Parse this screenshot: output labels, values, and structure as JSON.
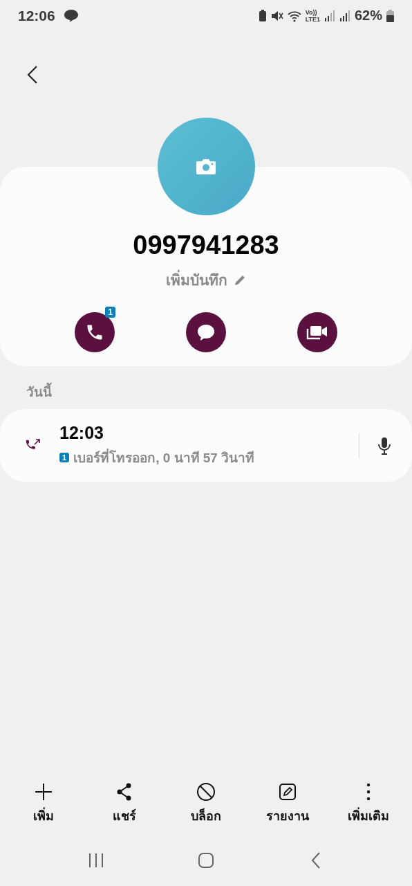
{
  "status_bar": {
    "time": "12:06",
    "volte": "Vo))",
    "network": "LTE1",
    "battery": "62%"
  },
  "contact": {
    "number": "0997941283",
    "note": "เพิ่มบันทึก"
  },
  "actions": [
    {
      "kind": "call",
      "badge": "1"
    },
    {
      "kind": "message"
    },
    {
      "kind": "video"
    }
  ],
  "section": "วันนี้",
  "calls": [
    {
      "kind": "outgoing",
      "time": "12:03",
      "sim": "1",
      "detail": "เบอร์ที่โทรออก, 0 นาที 57 วินาที"
    }
  ],
  "toolbar": [
    {
      "kind": "add",
      "label": "เพิ่ม"
    },
    {
      "kind": "share",
      "label": "แชร์"
    },
    {
      "kind": "block",
      "label": "บล็อก"
    },
    {
      "kind": "report",
      "label": "รายงาน"
    },
    {
      "kind": "more",
      "label": "เพิ่มเติม"
    }
  ]
}
